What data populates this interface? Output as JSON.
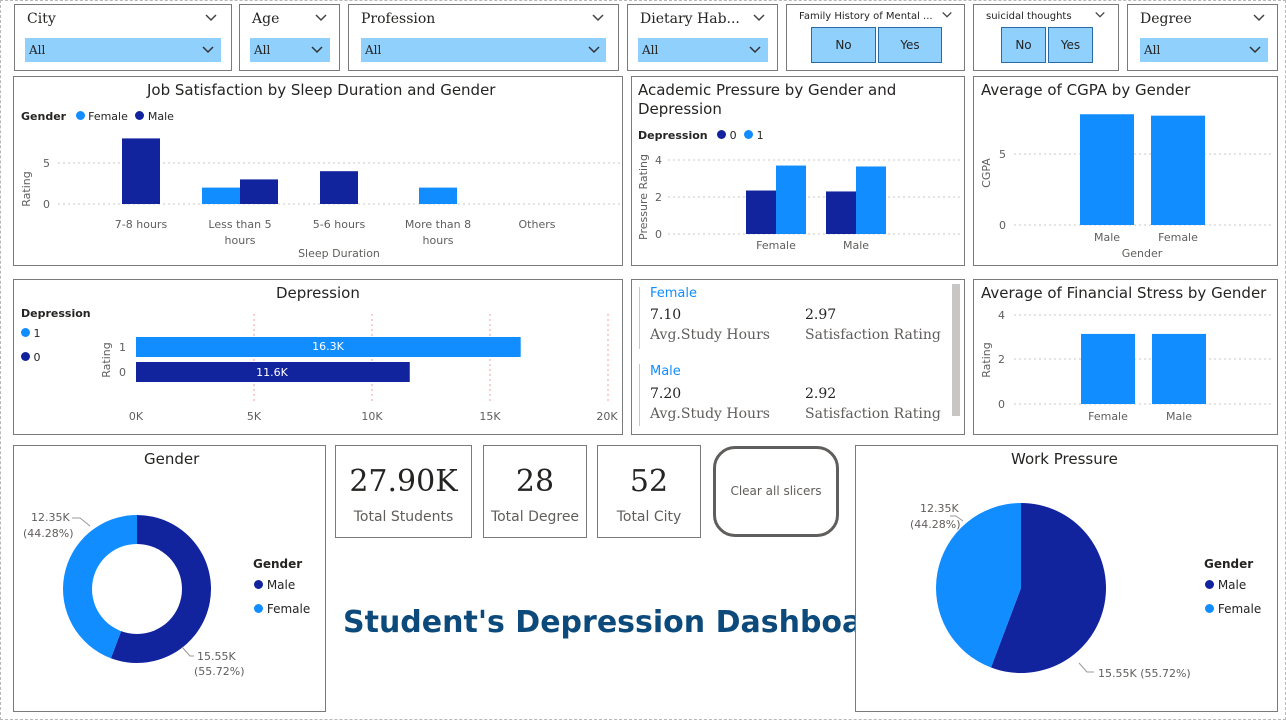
{
  "colors": {
    "light": "#118dff",
    "dark": "#12239e",
    "slicer_fill": "#8fd0fd",
    "title_blue": "#0c4a7c"
  },
  "slicers": {
    "city": {
      "label": "City",
      "value": "All"
    },
    "age": {
      "label": "Age",
      "value": "All"
    },
    "profession": {
      "label": "Profession",
      "value": "All"
    },
    "dietary": {
      "label": "Dietary Hab...",
      "value": "All"
    },
    "family_history": {
      "label": "Family History of Mental ...",
      "no": "No",
      "yes": "Yes"
    },
    "suicidal": {
      "label": "suicidal thoughts",
      "no": "No",
      "yes": "Yes"
    },
    "degree": {
      "label": "Degree",
      "value": "All"
    }
  },
  "job_satisfaction": {
    "title": "Job Satisfaction by Sleep Duration and Gender",
    "legend_title": "Gender",
    "legend": [
      "Female",
      "Male"
    ],
    "ylabel": "Rating",
    "xlabel": "Sleep Duration",
    "ticks": [
      "5",
      "0"
    ],
    "cat_labels": [
      [
        "7-8 hours"
      ],
      [
        "Less than 5",
        "hours"
      ],
      [
        "5-6 hours"
      ],
      [
        "More than 8",
        "hours"
      ],
      [
        "Others"
      ]
    ]
  },
  "academic_pressure": {
    "title_line1": "Academic Pressure by Gender and",
    "title_line2": "Depression",
    "legend_title": "Depression",
    "legend": [
      "0",
      "1"
    ],
    "ylabel": "Pressure Rating",
    "ticks": [
      "4",
      "2",
      "0"
    ],
    "categories": [
      "Female",
      "Male"
    ]
  },
  "cgpa": {
    "title": "Average of CGPA by Gender",
    "ylabel": "CGPA",
    "xlabel": "Gender",
    "ticks": [
      "5",
      "0"
    ],
    "categories": [
      "Male",
      "Female"
    ]
  },
  "depression": {
    "title": "Depression",
    "legend_title": "Depression",
    "legend": [
      "1",
      "0"
    ],
    "ylabel": "Rating",
    "bar_labels": [
      "16.3K",
      "11.6K"
    ],
    "ticks": [
      "0K",
      "5K",
      "10K",
      "15K",
      "20K"
    ],
    "categories": [
      "1",
      "0"
    ]
  },
  "study_card": {
    "female": {
      "name": "Female",
      "hours": "7.10",
      "hours_label": "Avg.Study Hours",
      "rating": "2.97",
      "rating_label": "Satisfaction Rating"
    },
    "male": {
      "name": "Male",
      "hours": "7.20",
      "hours_label": "Avg.Study Hours",
      "rating": "2.92",
      "rating_label": "Satisfaction Rating"
    }
  },
  "financial": {
    "title": "Average of Financial Stress by Gender",
    "ylabel": "Rating",
    "ticks": [
      "4",
      "2",
      "0"
    ],
    "categories": [
      "Female",
      "Male"
    ]
  },
  "gender_donut": {
    "title": "Gender",
    "legend_title": "Gender",
    "legend": [
      "Male",
      "Female"
    ],
    "label_female_1": "12.35K",
    "label_female_2": "(44.28%)",
    "label_male_1": "15.55K",
    "label_male_2": "(55.72%)"
  },
  "kpis": {
    "students": {
      "value": "27.90K",
      "label": "Total Students"
    },
    "degree": {
      "value": "28",
      "label": "Total Degree"
    },
    "city": {
      "value": "52",
      "label": "Total City"
    }
  },
  "clear_button": "Clear all slicers",
  "dashboard_title": "Student's Depression Dashboard",
  "work_pressure": {
    "title": "Work Pressure",
    "legend_title": "Gender",
    "legend": [
      "Male",
      "Female"
    ],
    "label_female_1": "12.35K",
    "label_female_2": "(44.28%)",
    "label_male": "15.55K (55.72%)"
  },
  "chart_data": [
    {
      "type": "bar",
      "title": "Job Satisfaction by Sleep Duration and Gender",
      "xlabel": "Sleep Duration",
      "ylabel": "Rating",
      "categories": [
        "7-8 hours",
        "Less than 5 hours",
        "5-6 hours",
        "More than 8 hours",
        "Others"
      ],
      "series": [
        {
          "name": "Female",
          "values": [
            0,
            2,
            0,
            2,
            0
          ]
        },
        {
          "name": "Male",
          "values": [
            8,
            3,
            4,
            0,
            0
          ]
        }
      ],
      "ylim": [
        0,
        9
      ]
    },
    {
      "type": "bar",
      "title": "Academic Pressure by Gender and Depression",
      "ylabel": "Pressure Rating",
      "categories": [
        "Female",
        "Male"
      ],
      "series": [
        {
          "name": "0",
          "values": [
            2.35,
            2.3
          ]
        },
        {
          "name": "1",
          "values": [
            3.7,
            3.65
          ]
        }
      ],
      "ylim": [
        0,
        4
      ]
    },
    {
      "type": "bar",
      "title": "Average of CGPA by Gender",
      "xlabel": "Gender",
      "ylabel": "CGPA",
      "categories": [
        "Male",
        "Female"
      ],
      "values": [
        7.8,
        7.7
      ],
      "ylim": [
        0,
        8.3
      ]
    },
    {
      "type": "bar",
      "orientation": "horizontal",
      "title": "Depression",
      "ylabel": "Rating",
      "categories": [
        "1",
        "0"
      ],
      "values": [
        16300,
        11600
      ],
      "xlim": [
        0,
        20000
      ]
    },
    {
      "type": "bar",
      "title": "Average of Financial Stress by Gender",
      "ylabel": "Rating",
      "categories": [
        "Female",
        "Male"
      ],
      "values": [
        3.15,
        3.15
      ],
      "ylim": [
        0,
        4
      ]
    },
    {
      "type": "pie",
      "variant": "donut",
      "title": "Gender",
      "categories": [
        "Male",
        "Female"
      ],
      "values": [
        15550,
        12350
      ]
    },
    {
      "type": "pie",
      "title": "Work Pressure",
      "categories": [
        "Male",
        "Female"
      ],
      "values": [
        15550,
        12350
      ]
    }
  ]
}
